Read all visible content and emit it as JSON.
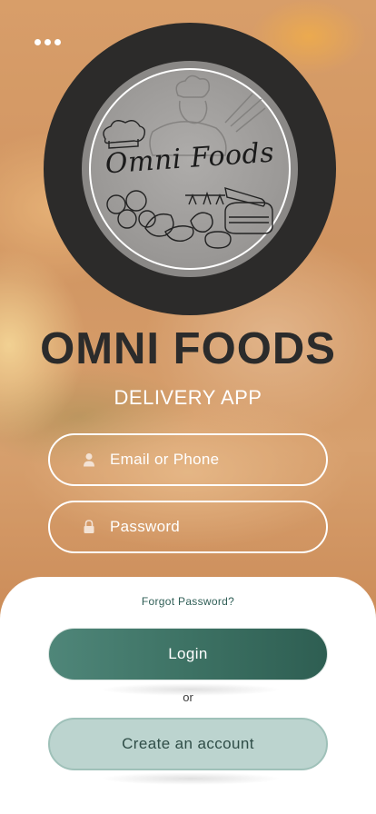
{
  "header": {
    "menu_icon": "more-horizontal-icon"
  },
  "logo": {
    "script_text": "Omni Foods"
  },
  "brand": {
    "title": "OMNI FOODS",
    "subtitle": "DELIVERY APP"
  },
  "form": {
    "email": {
      "placeholder": "Email or Phone",
      "value": "",
      "icon": "user-icon"
    },
    "password": {
      "placeholder": "Password",
      "value": "",
      "icon": "lock-icon"
    }
  },
  "sheet": {
    "forgot_label": "Forgot Password?",
    "login_label": "Login",
    "or_label": "or",
    "create_label": "Create an account"
  },
  "colors": {
    "primary_green": "#3d7264",
    "secondary_mint": "#bcd4cf",
    "dark_ring": "#2c2b2a"
  }
}
